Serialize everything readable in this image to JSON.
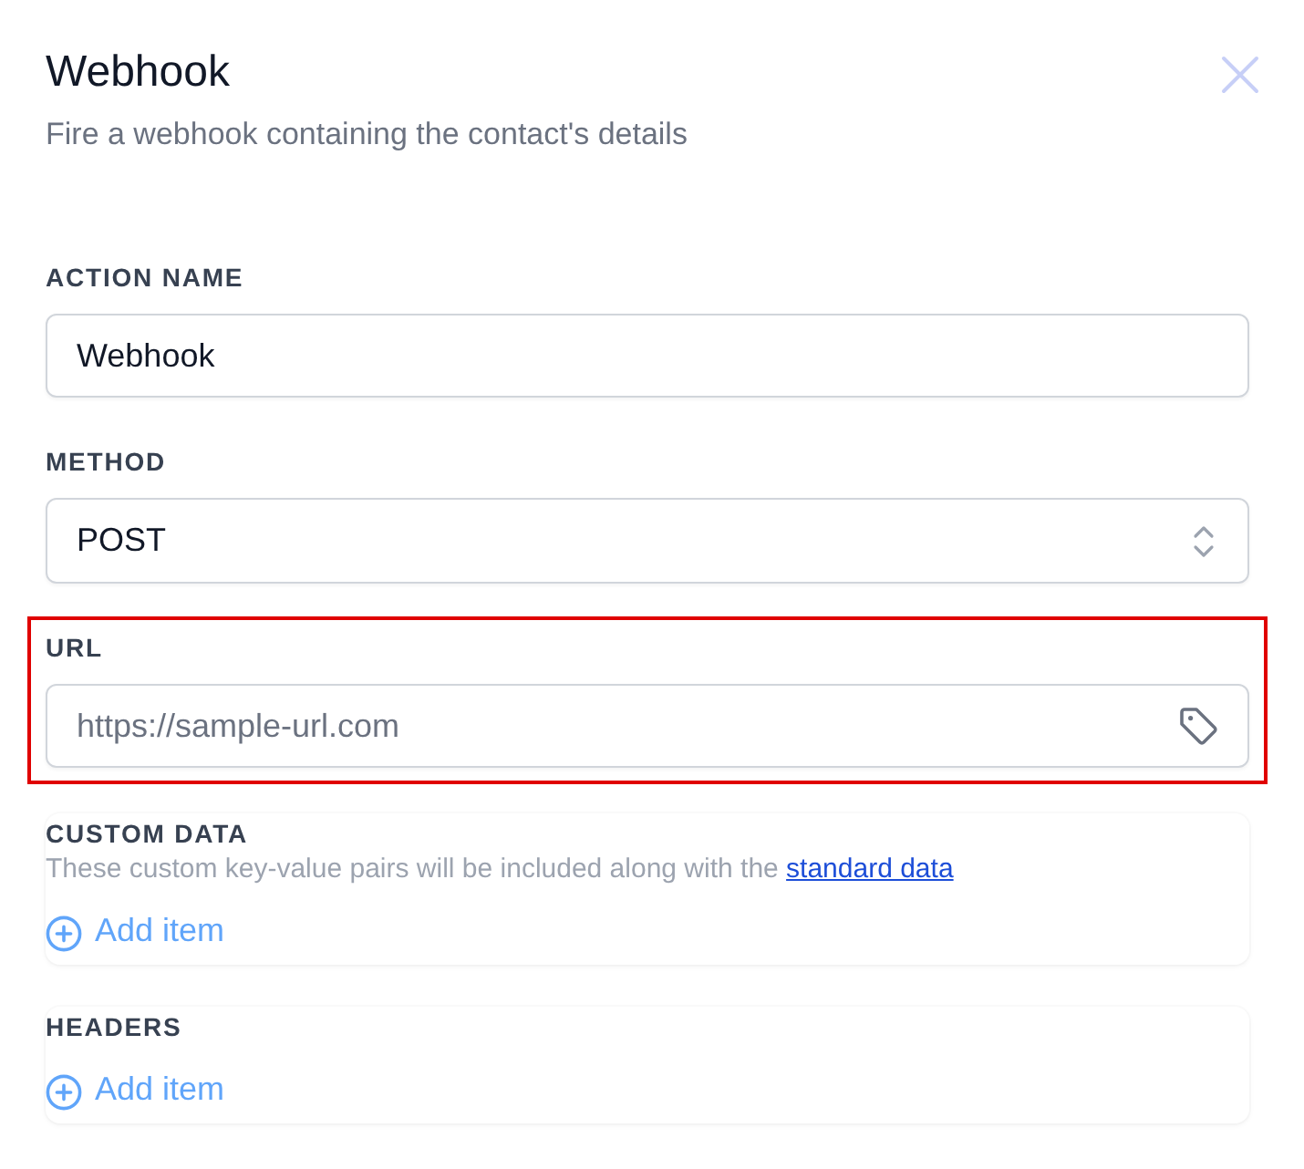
{
  "dialog": {
    "title": "Webhook",
    "subtitle": "Fire a webhook containing the contact's details"
  },
  "fields": [
    {
      "kind": "text",
      "label": "ACTION NAME",
      "value": "Webhook",
      "highlighted": false
    },
    {
      "kind": "select",
      "label": "METHOD",
      "value": "POST",
      "highlighted": false
    },
    {
      "kind": "tag-text",
      "label": "URL",
      "placeholder": "https://sample-url.com",
      "highlighted": true
    }
  ],
  "groups": [
    {
      "label": "CUSTOM DATA",
      "description": "These custom key-value pairs will be included along with the",
      "link": "standard data",
      "add_button": "Add item"
    },
    {
      "label": "HEADERS",
      "add_button": "Add item"
    }
  ]
}
